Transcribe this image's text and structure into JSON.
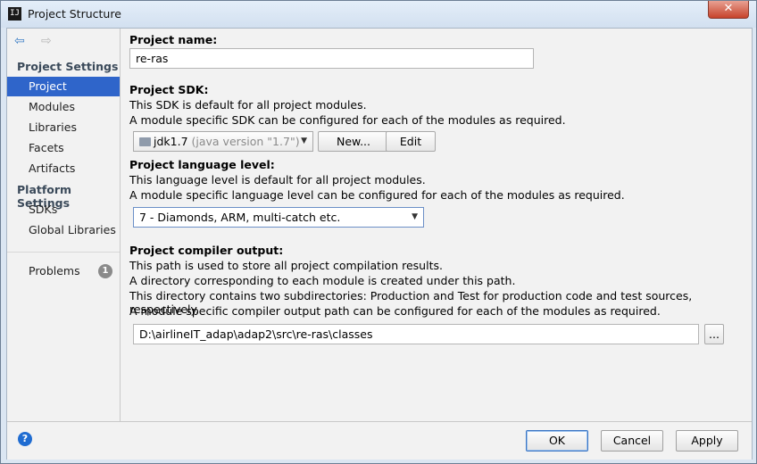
{
  "window": {
    "title": "Project Structure",
    "app_icon": "IJ",
    "close_glyph": "✕"
  },
  "nav": {
    "back_icon": "arrow-left-icon",
    "forward_icon": "arrow-right-icon",
    "back_glyph": "⇦",
    "forward_glyph": "⇨"
  },
  "sidebar": {
    "project_settings_header": "Project Settings",
    "project_settings": [
      "Project",
      "Modules",
      "Libraries",
      "Facets",
      "Artifacts"
    ],
    "platform_settings_header": "Platform Settings",
    "platform_settings": [
      "SDKs",
      "Global Libraries"
    ],
    "problems": {
      "label": "Problems",
      "count": "1"
    },
    "selected": "Project"
  },
  "project_name": {
    "label": "Project name:",
    "value": "re-ras"
  },
  "project_sdk": {
    "label": "Project SDK:",
    "line1": "This SDK is default for all project modules.",
    "line2": "A module specific SDK can be configured for each of the modules as required.",
    "selected": "jdk1.7",
    "selected_detail": "(java version \"1.7\")",
    "new_button": "New...",
    "edit_button": "Edit"
  },
  "language_level": {
    "label": "Project language level:",
    "line1": "This language level is default for all project modules.",
    "line2": "A module specific language level can be configured for each of the modules as required.",
    "selected": "7 - Diamonds, ARM, multi-catch etc."
  },
  "compiler_output": {
    "label": "Project compiler output:",
    "line1": "This path is used to store all project compilation results.",
    "line2": "A directory corresponding to each module is created under this path.",
    "line3": "This directory contains two subdirectories: Production and Test for production code and test sources, respectively.",
    "line4": "A module specific compiler output path can be configured for each of the modules as required.",
    "path": "D:\\airlineIT_adap\\adap2\\src\\re-ras\\classes",
    "browse_button": "..."
  },
  "footer": {
    "help_glyph": "?",
    "ok": "OK",
    "cancel": "Cancel",
    "apply": "Apply"
  },
  "colors": {
    "selection": "#2f65ca",
    "help": "#1f6cd1",
    "close": "#c7432b"
  }
}
